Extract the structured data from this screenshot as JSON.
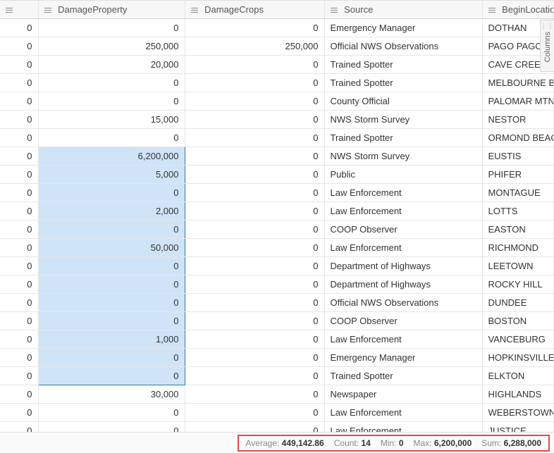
{
  "columns": {
    "c1": "DamageProperty",
    "c2": "DamageCrops",
    "c3": "Source",
    "c4": "BeginLocation"
  },
  "columnsPanelLabel": "Columns",
  "selection": {
    "startRow": 7,
    "endRow": 19,
    "col": "damageProperty"
  },
  "rows": [
    {
      "i": "0",
      "damageProperty": "0",
      "damageCrops": "0",
      "source": "Emergency Manager",
      "beginLocation": "DOTHAN"
    },
    {
      "i": "0",
      "damageProperty": "250,000",
      "damageCrops": "250,000",
      "source": "Official NWS Observations",
      "beginLocation": "PAGO PAGO"
    },
    {
      "i": "0",
      "damageProperty": "20,000",
      "damageCrops": "0",
      "source": "Trained Spotter",
      "beginLocation": "CAVE CREEK"
    },
    {
      "i": "0",
      "damageProperty": "0",
      "damageCrops": "0",
      "source": "Trained Spotter",
      "beginLocation": "MELBOURNE BEACH"
    },
    {
      "i": "0",
      "damageProperty": "0",
      "damageCrops": "0",
      "source": "County Official",
      "beginLocation": "PALOMAR MTN"
    },
    {
      "i": "0",
      "damageProperty": "15,000",
      "damageCrops": "0",
      "source": "NWS Storm Survey",
      "beginLocation": "NESTOR"
    },
    {
      "i": "0",
      "damageProperty": "0",
      "damageCrops": "0",
      "source": "Trained Spotter",
      "beginLocation": "ORMOND BEACH"
    },
    {
      "i": "0",
      "damageProperty": "6,200,000",
      "damageCrops": "0",
      "source": "NWS Storm Survey",
      "beginLocation": "EUSTIS"
    },
    {
      "i": "0",
      "damageProperty": "5,000",
      "damageCrops": "0",
      "source": "Public",
      "beginLocation": "PHIFER"
    },
    {
      "i": "0",
      "damageProperty": "0",
      "damageCrops": "0",
      "source": "Law Enforcement",
      "beginLocation": "MONTAGUE"
    },
    {
      "i": "0",
      "damageProperty": "2,000",
      "damageCrops": "0",
      "source": "Law Enforcement",
      "beginLocation": "LOTTS"
    },
    {
      "i": "0",
      "damageProperty": "0",
      "damageCrops": "0",
      "source": "COOP Observer",
      "beginLocation": "EASTON"
    },
    {
      "i": "0",
      "damageProperty": "50,000",
      "damageCrops": "0",
      "source": "Law Enforcement",
      "beginLocation": "RICHMOND"
    },
    {
      "i": "0",
      "damageProperty": "0",
      "damageCrops": "0",
      "source": "Department of Highways",
      "beginLocation": "LEETOWN"
    },
    {
      "i": "0",
      "damageProperty": "0",
      "damageCrops": "0",
      "source": "Department of Highways",
      "beginLocation": "ROCKY HILL"
    },
    {
      "i": "0",
      "damageProperty": "0",
      "damageCrops": "0",
      "source": "Official NWS Observations",
      "beginLocation": "DUNDEE"
    },
    {
      "i": "0",
      "damageProperty": "0",
      "damageCrops": "0",
      "source": "COOP Observer",
      "beginLocation": "BOSTON"
    },
    {
      "i": "0",
      "damageProperty": "1,000",
      "damageCrops": "0",
      "source": "Law Enforcement",
      "beginLocation": "VANCEBURG"
    },
    {
      "i": "0",
      "damageProperty": "0",
      "damageCrops": "0",
      "source": "Emergency Manager",
      "beginLocation": "HOPKINSVILLE A"
    },
    {
      "i": "0",
      "damageProperty": "0",
      "damageCrops": "0",
      "source": "Trained Spotter",
      "beginLocation": "ELKTON"
    },
    {
      "i": "0",
      "damageProperty": "30,000",
      "damageCrops": "0",
      "source": "Newspaper",
      "beginLocation": "HIGHLANDS"
    },
    {
      "i": "0",
      "damageProperty": "0",
      "damageCrops": "0",
      "source": "Law Enforcement",
      "beginLocation": "WEBERSTOWN"
    },
    {
      "i": "0",
      "damageProperty": "0",
      "damageCrops": "0",
      "source": "Law Enforcement",
      "beginLocation": "JUSTICE"
    }
  ],
  "stats": {
    "averageLabel": "Average:",
    "averageValue": "449,142.86",
    "countLabel": "Count:",
    "countValue": "14",
    "minLabel": "Min:",
    "minValue": "0",
    "maxLabel": "Max:",
    "maxValue": "6,200,000",
    "sumLabel": "Sum:",
    "sumValue": "6,288,000"
  }
}
